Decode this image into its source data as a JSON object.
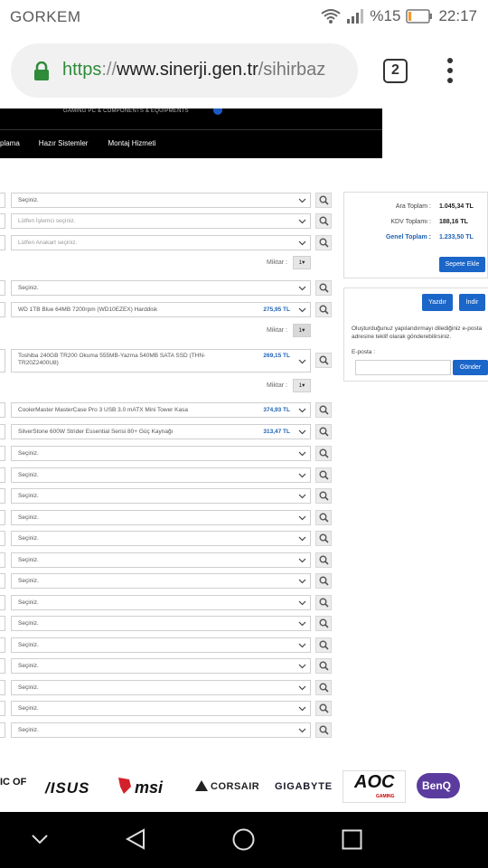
{
  "status": {
    "carrier": "GORKEM",
    "battery_percent": "%15",
    "battery_level": 0.15,
    "time": "22:17"
  },
  "browser": {
    "url_scheme": "https",
    "url_sep": "://",
    "url_host": "www.sinerji.gen.tr",
    "url_path": "/sihirbaz",
    "tab_count": "2"
  },
  "site": {
    "tagline": "GAMING PC & COMPONENTS & EQUIPMENTS",
    "nav": [
      "plama",
      "Hazır Sistemler",
      "Montaj Hizmeti"
    ]
  },
  "rows": [
    {
      "text": "Seçiniz.",
      "price": "",
      "muted": false
    },
    {
      "text": "Lütfen İşlemci seçiniz.",
      "price": "",
      "muted": true
    },
    {
      "text": "Lütfen Anakart seçiniz.",
      "price": "",
      "muted": true
    },
    {
      "text": "Seçiniz.",
      "price": "",
      "muted": false
    },
    {
      "text": "WD 1TB Blue 64MB 7200rpm (WD10EZEX) Harddisk",
      "price": "275,95 TL",
      "muted": false
    },
    {
      "text": "Toshiba 240GB TR200 Okuma 555MB-Yazma 540MB SATA SSD (THN-TR20Z2400U8)",
      "price": "269,15 TL",
      "muted": false
    },
    {
      "text": "CoolerMaster MasterCase Pro 3 USB 3.0 mATX Mini Tower Kasa",
      "price": "374,93 TL",
      "muted": false
    },
    {
      "text": "SilverStone 600W Strider Essential Serisi 80+ Güç Kaynağı",
      "price": "313,47 TL",
      "muted": false
    },
    {
      "text": "Seçiniz.",
      "price": "",
      "muted": false
    },
    {
      "text": "Seçiniz.",
      "price": "",
      "muted": false
    },
    {
      "text": "Seçiniz.",
      "price": "",
      "muted": false
    },
    {
      "text": "Seçiniz.",
      "price": "",
      "muted": false
    },
    {
      "text": "Seçiniz.",
      "price": "",
      "muted": false
    },
    {
      "text": "Seçiniz.",
      "price": "",
      "muted": false
    },
    {
      "text": "Seçiniz.",
      "price": "",
      "muted": false
    },
    {
      "text": "Seçiniz.",
      "price": "",
      "muted": false
    },
    {
      "text": "Seçiniz.",
      "price": "",
      "muted": false
    },
    {
      "text": "Seçiniz.",
      "price": "",
      "muted": false
    },
    {
      "text": "Seçiniz.",
      "price": "",
      "muted": false
    },
    {
      "text": "Seçiniz.",
      "price": "",
      "muted": false
    },
    {
      "text": "Seçiniz.",
      "price": "",
      "muted": false
    },
    {
      "text": "Seçiniz.",
      "price": "",
      "muted": false
    }
  ],
  "miktar": {
    "label": "Miktar :",
    "qty": "1"
  },
  "summary": {
    "subtotal_label": "Ara Toplam :",
    "subtotal": "1.045,34 TL",
    "vat_label": "KDV Toplamı :",
    "vat": "188,16 TL",
    "total_label": "Genel Toplam :",
    "total": "1.233,50 TL",
    "add_to_cart": "Sepete Ekle"
  },
  "share": {
    "print": "Yazdır",
    "download": "İndir",
    "description": "Oluşturduğunuz yapılandırmayı dilediğiniz e-posta adresine teklif olarak gönderebilirsiniz.",
    "email_label": "E-posta :",
    "send": "Gönder"
  },
  "brands": [
    "IC OF",
    "/ISUS",
    "msi",
    "CORSAIR",
    "GIGABYTE",
    "AOC",
    "GAMING",
    "BenQ"
  ],
  "colors": {
    "accent": "#1b66c9",
    "price": "#1f62b5",
    "https": "#2e8b3a"
  }
}
